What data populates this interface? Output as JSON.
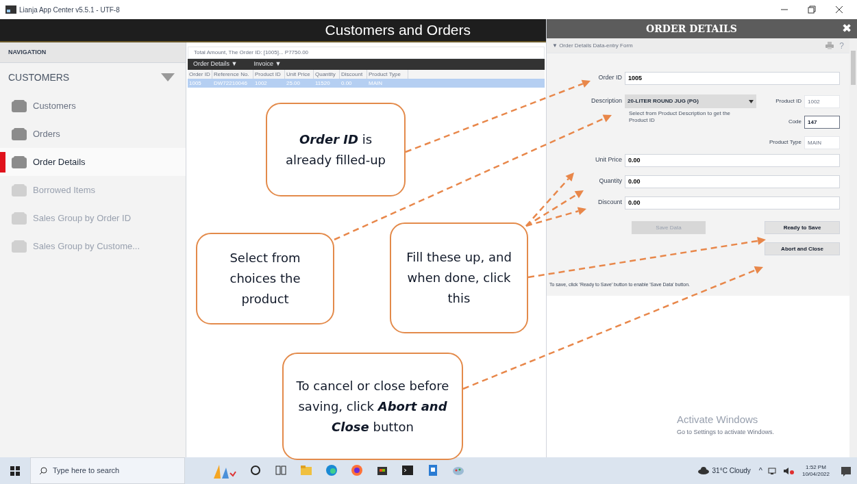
{
  "window": {
    "title": "Lianja App Center v5.5.1 - UTF-8"
  },
  "app_header": {
    "title": "Customers and Orders"
  },
  "sidebar": {
    "heading": "NAVIGATION",
    "section": "CUSTOMERS",
    "items": [
      {
        "label": "Customers",
        "selected": false,
        "disabled": false
      },
      {
        "label": "Orders",
        "selected": false,
        "disabled": false
      },
      {
        "label": "Order Details",
        "selected": true,
        "disabled": false
      },
      {
        "label": "Borrowed Items",
        "selected": false,
        "disabled": true
      },
      {
        "label": "Sales Group by Order ID",
        "selected": false,
        "disabled": true
      },
      {
        "label": "Sales Group by Custome...",
        "selected": false,
        "disabled": true
      }
    ]
  },
  "grid": {
    "summary": "Total Amount, The Order ID: [1005]... P7750.00",
    "tabs": [
      "Order Details ▼",
      "Invoice ▼"
    ],
    "columns": [
      "Order ID",
      "Reference No.",
      "Product ID",
      "Unit Price",
      "Quantity",
      "Discount",
      "Product Type"
    ],
    "rows": [
      {
        "selected": true,
        "cells": [
          "1005",
          "DW72210046",
          "1002",
          "25.00",
          "11520",
          "0.00",
          "MAIN"
        ]
      }
    ]
  },
  "panel": {
    "title": "ORDER DETAILS",
    "close": "✖",
    "subheader": "▼ Order Details Data-entry Form",
    "help": "?",
    "fields": [
      {
        "kind": "text",
        "label": "Order ID",
        "value": "1005"
      },
      {
        "kind": "select",
        "label": "Description",
        "value": "20-LITER ROUND JUG (PG)",
        "hint": "Select from Product Description to get the Product ID",
        "side": [
          {
            "label": "Product ID",
            "value": "1002",
            "bold": false
          },
          {
            "label": "Code",
            "value": "147",
            "bold": true
          },
          {
            "label": "Product Type",
            "value": "MAIN",
            "bold": false
          }
        ]
      },
      {
        "kind": "text",
        "label": "Unit Price",
        "value": "0.00"
      },
      {
        "kind": "text",
        "label": "Quantity",
        "value": "0.00"
      },
      {
        "kind": "text",
        "label": "Discount",
        "value": "0.00"
      }
    ],
    "buttons": [
      {
        "label": "Save Data",
        "disabled": true
      },
      {
        "label": "Ready to Save",
        "disabled": false
      },
      {
        "label": "Abort and Close",
        "disabled": false
      }
    ],
    "note": "To save, click 'Ready to Save' button to enable 'Save Data' button."
  },
  "activation": {
    "title": "Activate Windows",
    "text": "Go to Settings to activate Windows."
  },
  "callouts": [
    {
      "text": "**Order ID** is already filled-up"
    },
    {
      "text": "Select from choices the product"
    },
    {
      "text": "Fill these up, and when done, click this"
    },
    {
      "text": "To cancel or close before saving, click **Abort and Close** button"
    }
  ],
  "taskbar": {
    "search_placeholder": "Type here to search",
    "weather": "31°C Cloudy",
    "tray_caret": "^",
    "time": "1:52 PM",
    "date": "10/04/2022"
  }
}
